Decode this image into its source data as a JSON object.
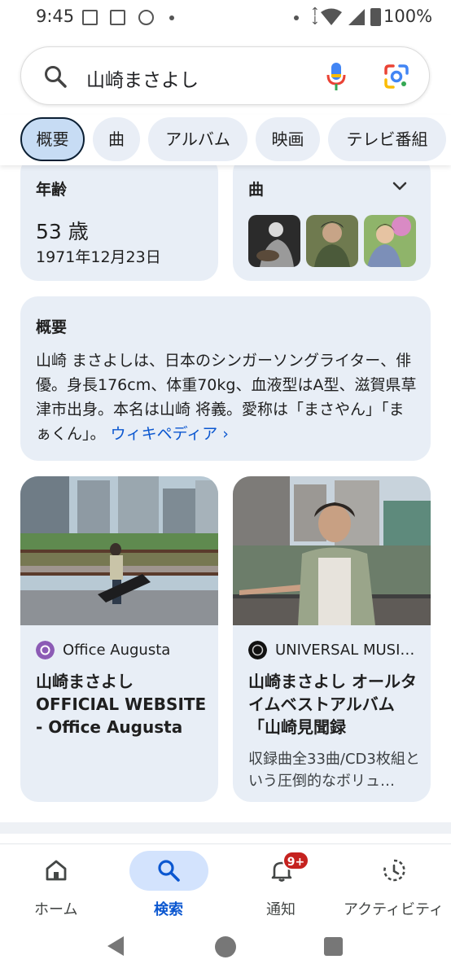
{
  "status_bar": {
    "time": "9:45",
    "battery": "100%"
  },
  "search": {
    "query": "山崎まさよし"
  },
  "chips": [
    "概要",
    "曲",
    "アルバム",
    "映画",
    "テレビ番組"
  ],
  "age_card": {
    "label": "年齢",
    "value": "53 歳",
    "birthdate": "1971年12月23日"
  },
  "songs_card": {
    "label": "曲"
  },
  "summary": {
    "label": "概要",
    "text": "山崎 まさよしは、日本のシンガーソングライター、俳優。身長176cm、体重70kg、血液型はA型、滋賀県草津市出身。本名は山崎 将義。愛称は「まさやん」「まぁくん」。",
    "link": "ウィキペディア ›"
  },
  "results": [
    {
      "source": "Office Augusta",
      "title": "山崎まさよし OFFICIAL WEBSITE - Office Augusta",
      "description": ""
    },
    {
      "source": "UNIVERSAL MUSI…",
      "title": "山崎まさよし オールタイムベストアルバム「山崎見聞録",
      "description": "収録曲全33曲/CD3枚組という圧倒的なボリュ…"
    }
  ],
  "bottom_nav": [
    {
      "label": "ホーム"
    },
    {
      "label": "検索"
    },
    {
      "label": "通知"
    },
    {
      "label": "アクティビティ"
    }
  ],
  "notification_badge": "9+",
  "colors": {
    "accent": "#0b57d0",
    "card_bg": "#e8eef6",
    "active_chip": "#c7dcf4",
    "badge": "#c5221f"
  }
}
